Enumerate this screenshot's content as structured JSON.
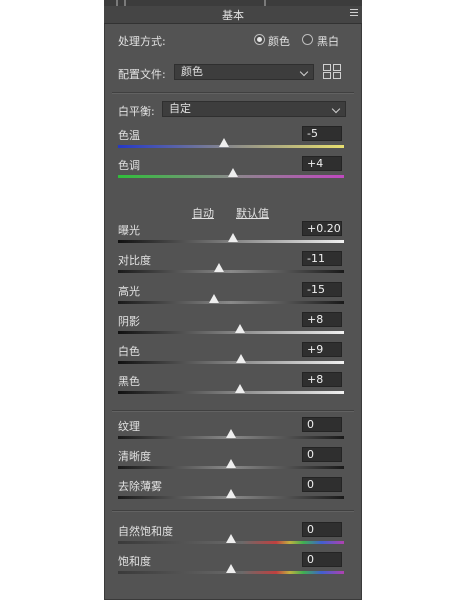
{
  "panel": {
    "title": "基本"
  },
  "process": {
    "label": "处理方式:",
    "options": [
      "颜色",
      "黑白"
    ],
    "selected": "颜色"
  },
  "profile": {
    "label": "配置文件:",
    "value": "颜色"
  },
  "white_balance": {
    "label": "白平衡:",
    "value": "自定"
  },
  "auto_label": "自动",
  "default_label": "默认值",
  "sliders": [
    {
      "name": "temp",
      "label": "色温",
      "value": "-5",
      "level": 0.47
    },
    {
      "name": "tint",
      "label": "色调",
      "value": "+4",
      "level": 0.51
    },
    {
      "name": "exposure",
      "label": "曝光",
      "value": "+0.20",
      "level": 0.51
    },
    {
      "name": "contrast",
      "label": "对比度",
      "value": "-11",
      "level": 0.445
    },
    {
      "name": "highlights",
      "label": "高光",
      "value": "-15",
      "level": 0.425
    },
    {
      "name": "shadows",
      "label": "阴影",
      "value": "+8",
      "level": 0.54
    },
    {
      "name": "whites",
      "label": "白色",
      "value": "+9",
      "level": 0.545
    },
    {
      "name": "blacks",
      "label": "黑色",
      "value": "+8",
      "level": 0.54
    },
    {
      "name": "texture",
      "label": "纹理",
      "value": "0",
      "level": 0.5
    },
    {
      "name": "clarity",
      "label": "清晰度",
      "value": "0",
      "level": 0.5
    },
    {
      "name": "dehaze",
      "label": "去除薄雾",
      "value": "0",
      "level": 0.5
    },
    {
      "name": "vibrance",
      "label": "自然饱和度",
      "value": "0",
      "level": 0.5
    },
    {
      "name": "saturation",
      "label": "饱和度",
      "value": "0",
      "level": 0.5
    }
  ],
  "colors": {
    "panel": "#535353",
    "field": "#2f2f2f",
    "text": "#e2e2e2",
    "temp_gradient": [
      "#2438c8",
      "#e8e070"
    ],
    "tint_gradient": [
      "#2fbf3a",
      "#c048c0"
    ]
  }
}
